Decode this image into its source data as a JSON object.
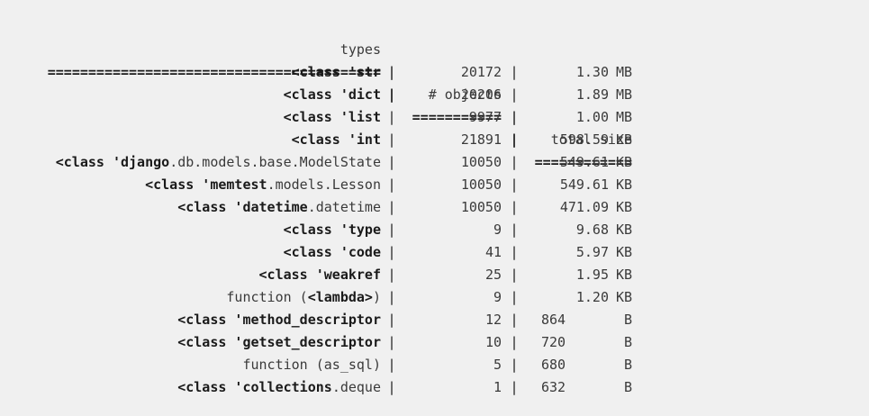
{
  "header": {
    "types": "types",
    "objects": "# objects",
    "size": "total size",
    "sep": "|"
  },
  "rule": {
    "types": "=========================================",
    "objects": "===========",
    "size": "============"
  },
  "rows": [
    {
      "pre": "<class '",
      "name": "str",
      "post": "",
      "bold_post": false,
      "count": "20172",
      "size": "1.30",
      "unit": "MB"
    },
    {
      "pre": "<class '",
      "name": "dict",
      "post": "",
      "count": "20206",
      "size": "1.89",
      "unit": "MB"
    },
    {
      "pre": "<class '",
      "name": "list",
      "post": "",
      "count": "9977",
      "size": "1.00",
      "unit": "MB"
    },
    {
      "pre": "<class '",
      "name": "int",
      "post": "",
      "count": "21891",
      "size": "598.59",
      "unit": "KB"
    },
    {
      "pre": "<class '",
      "name": "django",
      "post": ".db.models.base.ModelState",
      "count": "10050",
      "size": "549.61",
      "unit": "KB"
    },
    {
      "pre": "<class '",
      "name": "memtest",
      "post": ".models.Lesson",
      "count": "10050",
      "size": "549.61",
      "unit": "KB"
    },
    {
      "pre": "<class '",
      "name": "datetime",
      "post": ".datetime",
      "count": "10050",
      "size": "471.09",
      "unit": "KB"
    },
    {
      "pre": "<class '",
      "name": "type",
      "post": "",
      "count": "9",
      "size": "9.68",
      "unit": "KB"
    },
    {
      "pre": "<class '",
      "name": "code",
      "post": "",
      "count": "41",
      "size": "5.97",
      "unit": "KB"
    },
    {
      "pre": "<class '",
      "name": "weakref",
      "post": "",
      "count": "25",
      "size": "1.95",
      "unit": "KB"
    },
    {
      "pre": "function (",
      "name": "<lambda>",
      "post": ")",
      "plain_pre": true,
      "count": "9",
      "size": "1.20",
      "unit": "KB"
    },
    {
      "pre": "<class '",
      "name": "method_descriptor",
      "post": "",
      "count": "12",
      "size": "864",
      "unit": "B"
    },
    {
      "pre": "<class '",
      "name": "getset_descriptor",
      "post": "",
      "count": "10",
      "size": "720",
      "unit": "B"
    },
    {
      "pre": "function (as_sql)",
      "name": "",
      "post": "",
      "plain_pre": true,
      "count": "5",
      "size": "680",
      "unit": "B"
    },
    {
      "pre": "<class '",
      "name": "collections",
      "post": ".deque",
      "count": "1",
      "size": "632",
      "unit": "B"
    }
  ]
}
